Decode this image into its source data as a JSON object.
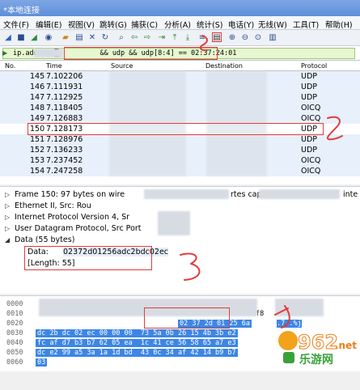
{
  "window": {
    "title": "*本地连接"
  },
  "menu": [
    "文件(F)",
    "编辑(E)",
    "视图(V)",
    "跳转(G)",
    "捕获(C)",
    "分析(A)",
    "统计(S)",
    "电话(Y)",
    "无线(W)",
    "工具(T)",
    "帮助(H)"
  ],
  "toolbar_icons": [
    "shark-fin-icon",
    "stop-icon",
    "restart-icon",
    "options-icon",
    "open-icon",
    "save-icon",
    "close-file-icon",
    "reload-icon",
    "find-icon",
    "back-icon",
    "forward-icon",
    "goto-icon",
    "first-icon",
    "last-icon",
    "autoscroll-icon",
    "colorize-icon",
    "zoom-in-icon",
    "zoom-out-icon",
    "zoom-reset-icon",
    "resize-columns-icon"
  ],
  "filter": {
    "value": "ip.addr==1█          && udp && udp[8:4] == 02:37:24:01"
  },
  "packet_list": {
    "columns": [
      "No.",
      "Time",
      "Source",
      "Destination",
      "Protocol"
    ],
    "rows": [
      {
        "no": "145",
        "time": "7.102206",
        "proto": "UDP"
      },
      {
        "no": "146",
        "time": "7.111931",
        "proto": "UDP"
      },
      {
        "no": "147",
        "time": "7.112925",
        "proto": "UDP"
      },
      {
        "no": "148",
        "time": "7.118405",
        "proto": "OICQ"
      },
      {
        "no": "149",
        "time": "7.126883",
        "proto": "OICQ"
      },
      {
        "no": "150",
        "time": "7.128173",
        "proto": "UDP"
      },
      {
        "no": "151",
        "time": "7.128976",
        "proto": "UDP"
      },
      {
        "no": "152",
        "time": "7.136233",
        "proto": "UDP"
      },
      {
        "no": "153",
        "time": "7.237452",
        "proto": "OICQ"
      },
      {
        "no": "154",
        "time": "7.247258",
        "proto": "OICQ"
      }
    ]
  },
  "details": [
    {
      "exp": "▷",
      "text": "Frame 150: 97 bytes on wire",
      "tail": "rtes cap",
      "tail2": "inte"
    },
    {
      "exp": "▷",
      "text": "Ethernet II, Src: Rou",
      "tail": "",
      "tail2": ""
    },
    {
      "exp": "▷",
      "text": "Internet Protocol Version 4, Sr",
      "tail": "",
      "tail2": ""
    },
    {
      "exp": "▷",
      "text": "User Datagram Protocol, Src Port",
      "tail": "",
      "tail2": ""
    },
    {
      "exp": "◢",
      "text": "Data (55 bytes)",
      "tail": "",
      "tail2": ""
    }
  ],
  "data_field": {
    "label": "Data: ",
    "value": "02372d01256adc2bdc02ec"
  },
  "length_field": "[Length: 55]",
  "hex": [
    {
      "off": "0000",
      "bytes": "",
      "ascii": ""
    },
    {
      "off": "0010",
      "bytes": "",
      "ascii": ""
    },
    {
      "off": "0020",
      "bytes": "02 37 2d 01 25 6a",
      "ascii": ".7..%j"
    },
    {
      "off": "0030",
      "bytes": "dc 2b dc 02 ec 00 00 00  73 5a 0b 26 15 4b 3b e2",
      "ascii": ""
    },
    {
      "off": "0040",
      "bytes": "fc af d7 b3 b7 62 05 ea  1c 41 ce 56 58 65 a7 e3",
      "ascii": ""
    },
    {
      "off": "0050",
      "bytes": "dc e2 99 a5 3a 1a 1d bd  43 0c 34 af 42 14 b9 b7",
      "ascii": ""
    },
    {
      "off": "0060",
      "bytes": "03",
      "ascii": ""
    }
  ],
  "watermark": {
    "brand": "962",
    "suffix": ".net",
    "sub": "乐游网"
  }
}
